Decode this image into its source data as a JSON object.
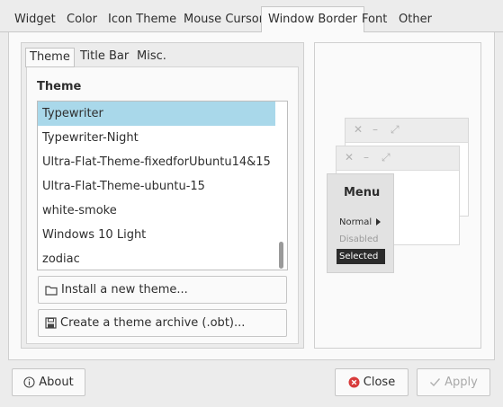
{
  "top_tabs": [
    "Widget",
    "Color",
    "Icon Theme",
    "Mouse Cursor",
    "Window Border",
    "Font",
    "Other"
  ],
  "sub_tabs": [
    "Theme",
    "Title Bar",
    "Misc."
  ],
  "theme_section": {
    "title": "Theme",
    "items": [
      "Typewriter",
      "Typewriter-Night",
      "Ultra-Flat-Theme-fixedforUbuntu14&15",
      "Ultra-Flat-Theme-ubuntu-15",
      "white-smoke",
      "Windows 10 Light",
      "zodiac"
    ],
    "selected": "Typewriter"
  },
  "actions": {
    "install": "Install a new theme...",
    "archive": "Create a theme archive (.obt)..."
  },
  "preview": {
    "controls": [
      "✕",
      "–",
      "⤢"
    ],
    "menu_title": "Menu",
    "menu_normal": "Normal",
    "menu_disabled": "Disabled",
    "menu_selected": "Selected"
  },
  "footer": {
    "about": "About",
    "close": "Close",
    "apply": "Apply"
  },
  "colors": {
    "selection": "#a9d8ea",
    "close_icon": "#d83b3b"
  }
}
